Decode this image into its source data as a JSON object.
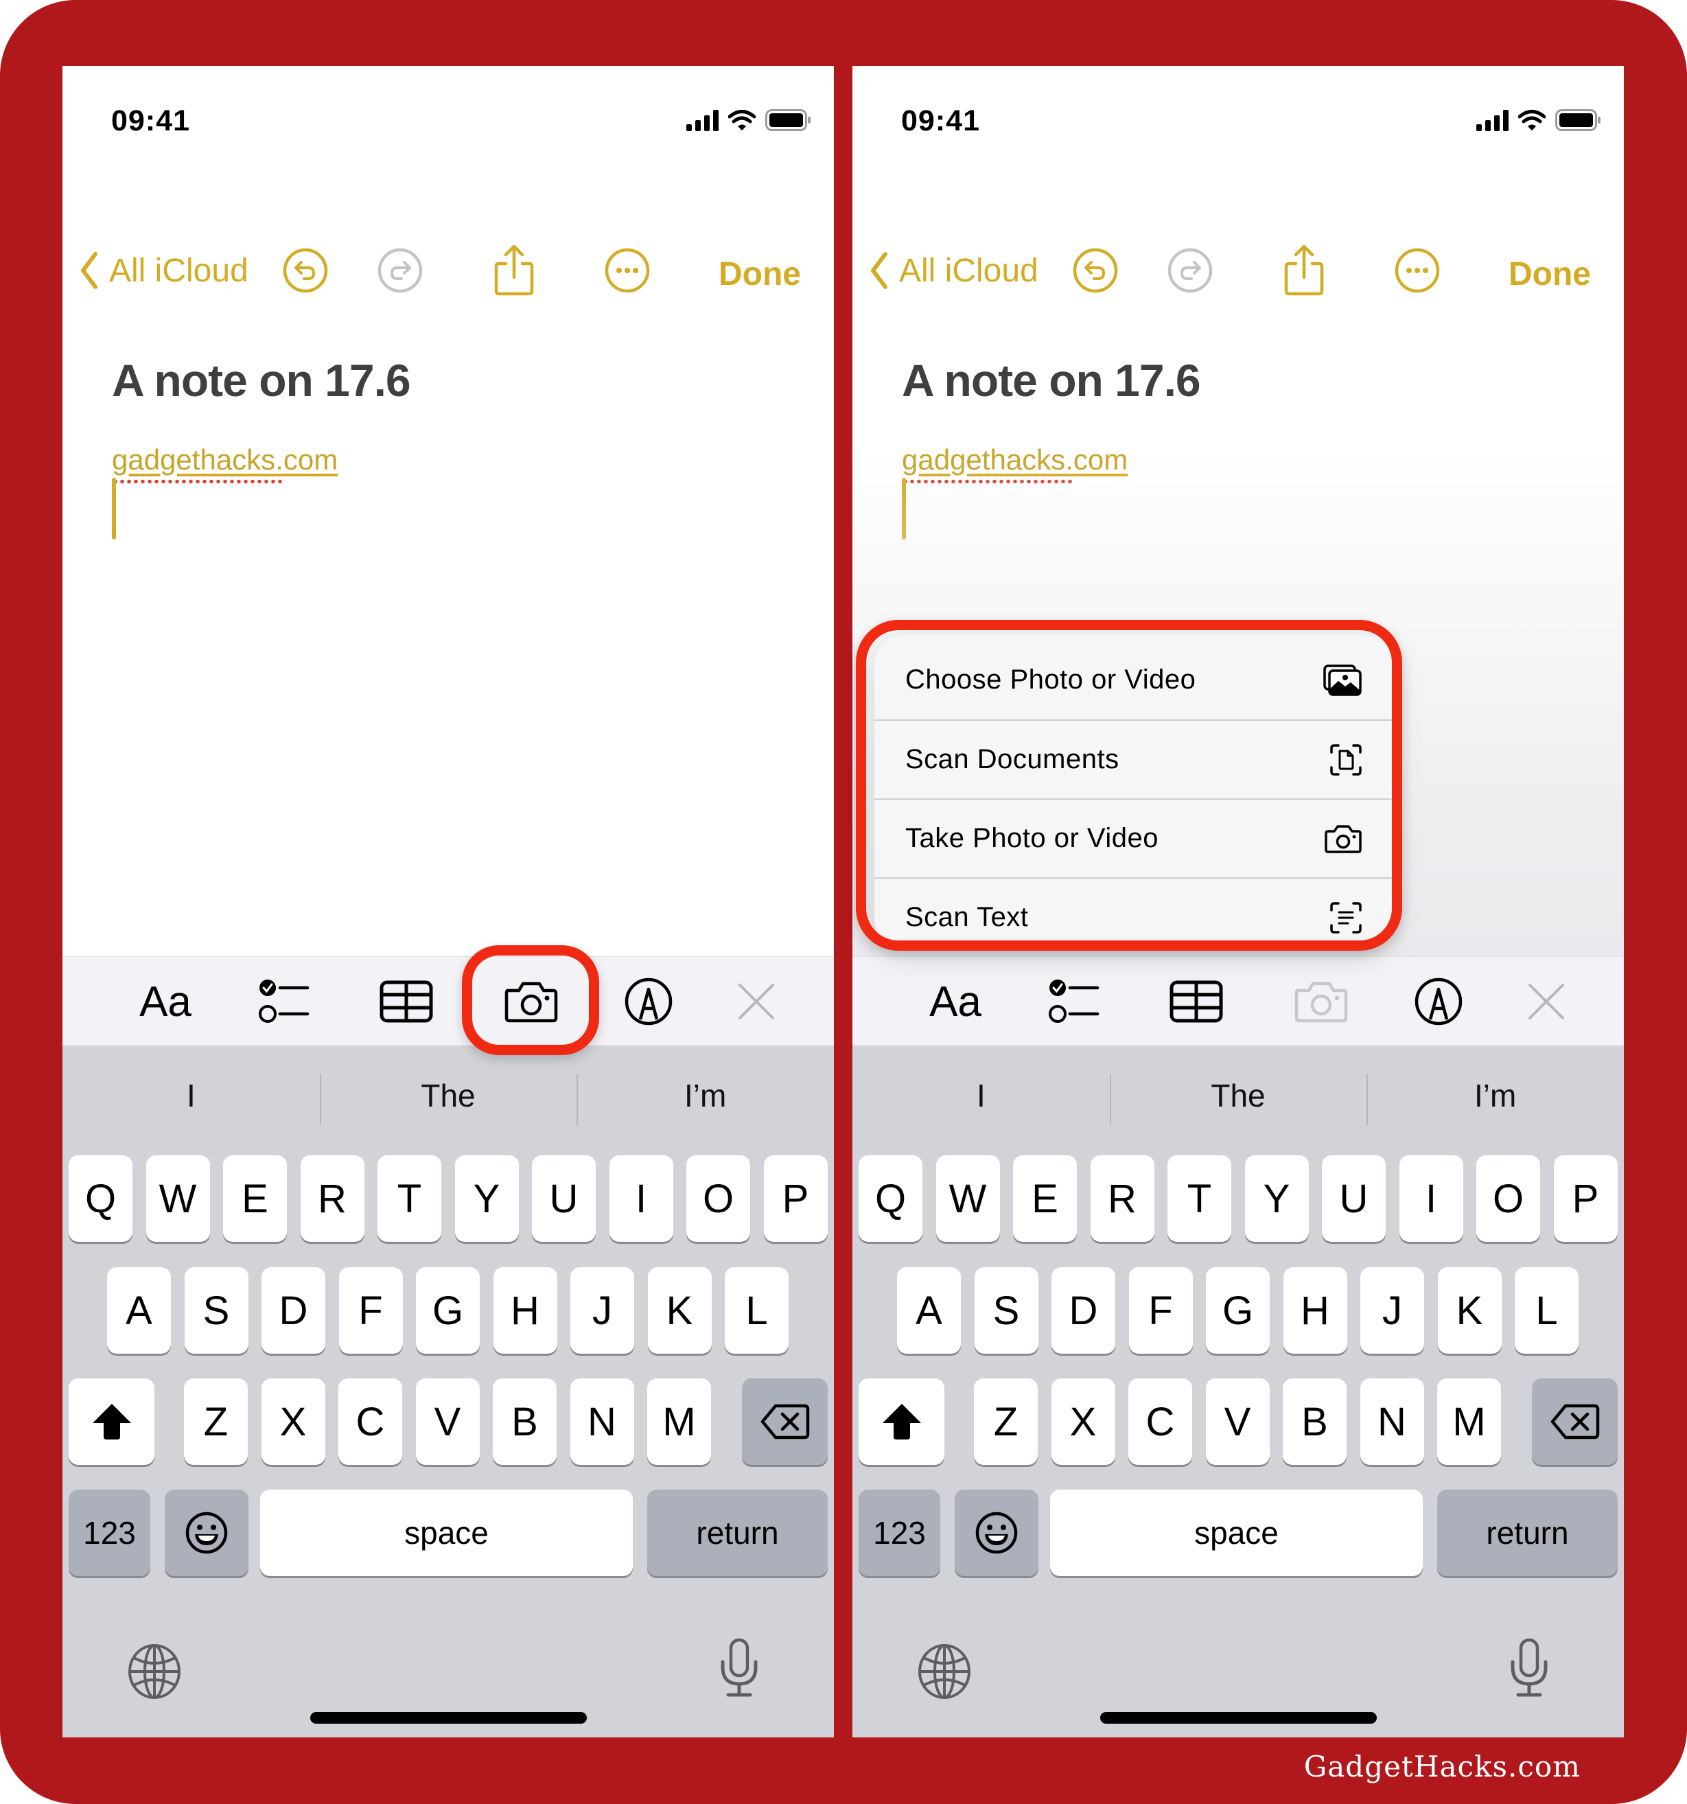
{
  "colors": {
    "frame": "#b1181c",
    "accent": "#d4ab24",
    "highlight": "#f02a12",
    "keyboard_bg": "#d1d3d9",
    "toolbar_bg": "#f2f2f7"
  },
  "watermark": "GadgetHacks.com",
  "panels": [
    {
      "status": {
        "time": "09:41",
        "icons": [
          "cellular-signal-icon",
          "wifi-icon",
          "battery-icon"
        ]
      },
      "nav": {
        "back_label": "All iCloud",
        "icons": [
          "chevron-left-icon",
          "undo-icon",
          "redo-icon",
          "share-icon",
          "more-icon"
        ],
        "done_label": "Done"
      },
      "note": {
        "title": "A note on 17.6",
        "link": "gadgethacks.com"
      },
      "toolbar": {
        "format_label": "Aa",
        "icons": [
          "checklist-icon",
          "table-icon",
          "camera-icon",
          "markup-icon",
          "close-icon"
        ],
        "camera_highlighted": true
      },
      "keyboard": {
        "predictions": [
          "I",
          "The",
          "I’m"
        ],
        "row1": [
          "Q",
          "W",
          "E",
          "R",
          "T",
          "Y",
          "U",
          "I",
          "O",
          "P"
        ],
        "row2": [
          "A",
          "S",
          "D",
          "F",
          "G",
          "H",
          "J",
          "K",
          "L"
        ],
        "row3": [
          "Z",
          "X",
          "C",
          "V",
          "B",
          "N",
          "M"
        ],
        "numbers_label": "123",
        "space_label": "space",
        "return_label": "return"
      }
    },
    {
      "status": {
        "time": "09:41",
        "icons": [
          "cellular-signal-icon",
          "wifi-icon",
          "battery-icon"
        ]
      },
      "nav": {
        "back_label": "All iCloud",
        "icons": [
          "chevron-left-icon",
          "undo-icon",
          "redo-icon",
          "share-icon",
          "more-icon"
        ],
        "done_label": "Done"
      },
      "note": {
        "title": "A note on 17.6",
        "link": "gadgethacks.com"
      },
      "toolbar": {
        "format_label": "Aa",
        "icons": [
          "checklist-icon",
          "table-icon",
          "camera-icon",
          "markup-icon",
          "close-icon"
        ],
        "camera_highlighted": false
      },
      "menu": {
        "items": [
          {
            "label": "Choose Photo or Video",
            "icon": "photo-library-icon"
          },
          {
            "label": "Scan Documents",
            "icon": "scan-document-icon"
          },
          {
            "label": "Take Photo or Video",
            "icon": "camera-icon"
          },
          {
            "label": "Scan Text",
            "icon": "scan-text-icon"
          }
        ]
      },
      "keyboard": {
        "predictions": [
          "I",
          "The",
          "I’m"
        ],
        "row1": [
          "Q",
          "W",
          "E",
          "R",
          "T",
          "Y",
          "U",
          "I",
          "O",
          "P"
        ],
        "row2": [
          "A",
          "S",
          "D",
          "F",
          "G",
          "H",
          "J",
          "K",
          "L"
        ],
        "row3": [
          "Z",
          "X",
          "C",
          "V",
          "B",
          "N",
          "M"
        ],
        "numbers_label": "123",
        "space_label": "space",
        "return_label": "return"
      }
    }
  ]
}
